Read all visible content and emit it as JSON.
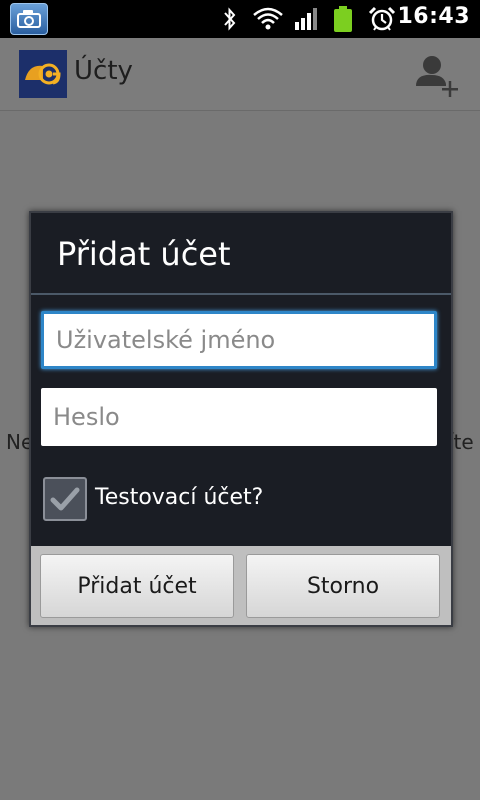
{
  "status_bar": {
    "time": "16:43",
    "icons": [
      "camera-notification-icon",
      "bluetooth-icon",
      "wifi-icon",
      "signal-icon",
      "battery-icon",
      "alarm-icon"
    ]
  },
  "action_bar": {
    "title": "Účty",
    "logo_icon": "mail-at-icon",
    "add_account_icon": "add-person-icon"
  },
  "background": {
    "text_left": "Ne",
    "text_right": "íte"
  },
  "dialog": {
    "title": "Přidat účet",
    "username_placeholder": "Uživatelské jméno",
    "password_placeholder": "Heslo",
    "checkbox_label": "Testovací účet?",
    "checkbox_checked": true,
    "add_button": "Přidat účet",
    "cancel_button": "Storno"
  },
  "colors": {
    "focus_border": "#2e86c8",
    "dialog_bg": "#1a1d24",
    "battery": "#7ccf20"
  }
}
